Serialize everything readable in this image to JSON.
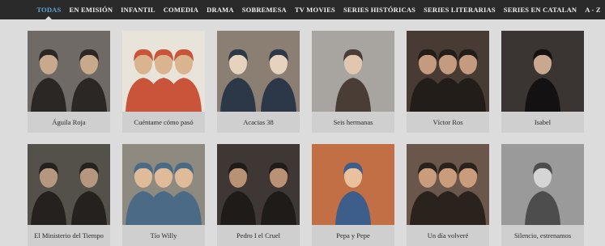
{
  "nav": {
    "items": [
      {
        "label": "TODAS",
        "active": true
      },
      {
        "label": "EN EMISIÓN",
        "active": false
      },
      {
        "label": "INFANTIL",
        "active": false
      },
      {
        "label": "COMEDIA",
        "active": false
      },
      {
        "label": "DRAMA",
        "active": false
      },
      {
        "label": "SOBREMESA",
        "active": false
      },
      {
        "label": "TV MOVIES",
        "active": false
      },
      {
        "label": "SERIES HISTÓRICAS",
        "active": false
      },
      {
        "label": "SERIES LITERARIAS",
        "active": false
      },
      {
        "label": "SERIES EN CATALAN",
        "active": false
      },
      {
        "label": "A - Z",
        "active": false
      }
    ]
  },
  "series": [
    {
      "title": "Águila Roja",
      "colors": [
        "#6f6a66",
        "#2b2724",
        "#c9a98c"
      ]
    },
    {
      "title": "Cuéntame cómo pasó",
      "colors": [
        "#e8e4da",
        "#c9543a",
        "#d9b48f"
      ]
    },
    {
      "title": "Acacias 38",
      "colors": [
        "#8a7f72",
        "#2c3748",
        "#e6d2bd"
      ]
    },
    {
      "title": "Seis hermanas",
      "colors": [
        "#a8a5a0",
        "#4a3d36",
        "#e2c7b0"
      ]
    },
    {
      "title": "Víctor Ros",
      "colors": [
        "#473b33",
        "#231d19",
        "#c49b7e"
      ]
    },
    {
      "title": "Isabel",
      "colors": [
        "#3a3533",
        "#131111",
        "#c8a88f"
      ]
    },
    {
      "title": "El Ministerio del Tiempo",
      "colors": [
        "#54504a",
        "#24211e",
        "#b59780"
      ]
    },
    {
      "title": "Tío Willy",
      "colors": [
        "#8f8a80",
        "#4b6a85",
        "#e0bb9a"
      ]
    },
    {
      "title": "Pedro I el Cruel",
      "colors": [
        "#3e3733",
        "#1f1b19",
        "#b99276"
      ]
    },
    {
      "title": "Pepa y Pepe",
      "colors": [
        "#c36f45",
        "#3d5d8a",
        "#e9c19f"
      ]
    },
    {
      "title": "Un día volveré",
      "colors": [
        "#6a564a",
        "#2a221d",
        "#c99d7c"
      ]
    },
    {
      "title": "Silencio, estrenamos",
      "colors": [
        "#9a9a9a",
        "#4d4d4d",
        "#d5d5d5"
      ]
    }
  ]
}
